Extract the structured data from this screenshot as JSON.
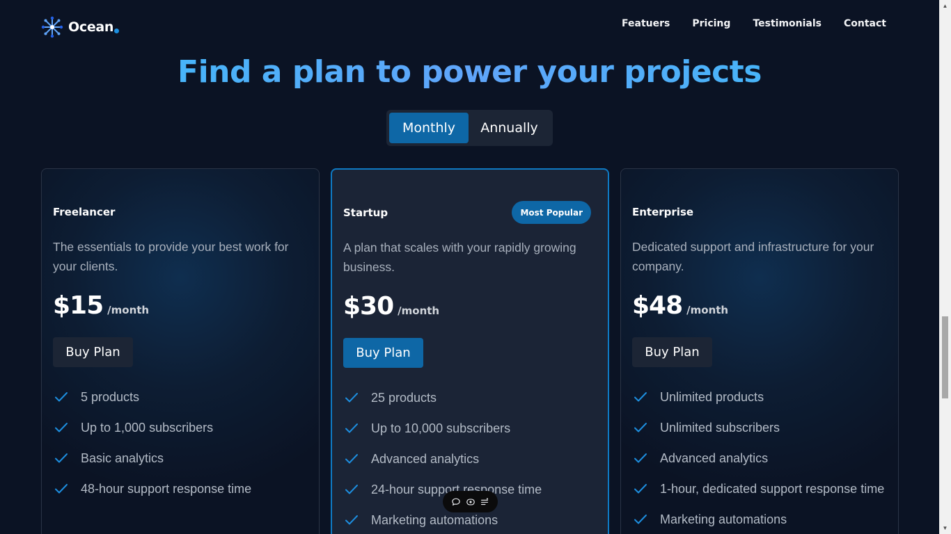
{
  "brand": {
    "name": "Ocean",
    "accent": "#1d8fe0"
  },
  "nav": [
    {
      "label": "Featuers"
    },
    {
      "label": "Pricing"
    },
    {
      "label": "Testimonials"
    },
    {
      "label": "Contact"
    }
  ],
  "hero": {
    "title": "Find a plan to power your projects"
  },
  "billing_toggle": {
    "options": [
      "Monthly",
      "Annually"
    ],
    "selected": "Monthly"
  },
  "plans": [
    {
      "name": "Freelancer",
      "description": "The essentials to provide your best work for your clients.",
      "price": "$15",
      "period": "/month",
      "cta": "Buy Plan",
      "features": [
        "5 products",
        "Up to 1,000 subscribers",
        "Basic analytics",
        "48-hour support response time"
      ]
    },
    {
      "name": "Startup",
      "badge": "Most Popular",
      "description": "A plan that scales with your rapidly growing business.",
      "price": "$30",
      "period": "/month",
      "cta": "Buy Plan",
      "features": [
        "25 products",
        "Up to 10,000 subscribers",
        "Advanced analytics",
        "24-hour support response time",
        "Marketing automations"
      ]
    },
    {
      "name": "Enterprise",
      "description": "Dedicated support and infrastructure for your company.",
      "price": "$48",
      "period": "/month",
      "cta": "Buy Plan",
      "features": [
        "Unlimited products",
        "Unlimited subscribers",
        "Advanced analytics",
        "1-hour, dedicated support response time",
        "Marketing automations"
      ]
    }
  ],
  "floating_toolbar": {
    "icons": [
      "chat-icon",
      "eye-icon",
      "list-icon"
    ]
  }
}
